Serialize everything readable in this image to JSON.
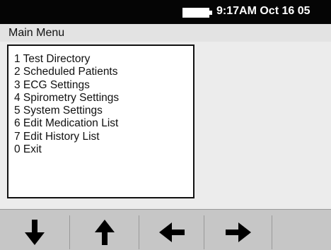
{
  "status_bar": {
    "battery_icon": "battery-icon",
    "time_date": "9:17AM Oct 16 05"
  },
  "header": {
    "title": "Main Menu"
  },
  "menu": {
    "items": [
      {
        "label": "1 Test Directory"
      },
      {
        "label": "2 Scheduled Patients"
      },
      {
        "label": "3 ECG Settings"
      },
      {
        "label": "4 Spirometry Settings"
      },
      {
        "label": "5 System Settings"
      },
      {
        "label": "6 Edit Medication List"
      },
      {
        "label": "7 Edit History List"
      },
      {
        "label": "0 Exit"
      }
    ]
  },
  "softkeys": [
    {
      "icon": "arrow-down-icon"
    },
    {
      "icon": "arrow-up-icon"
    },
    {
      "icon": "arrow-left-icon"
    },
    {
      "icon": "arrow-right-icon"
    },
    {
      "icon": ""
    }
  ],
  "colors": {
    "status_bar_bg": "#050505",
    "status_text": "#ffffff",
    "menu_bg": "#ffffff",
    "softkey_bar": "#c6c6c6"
  }
}
